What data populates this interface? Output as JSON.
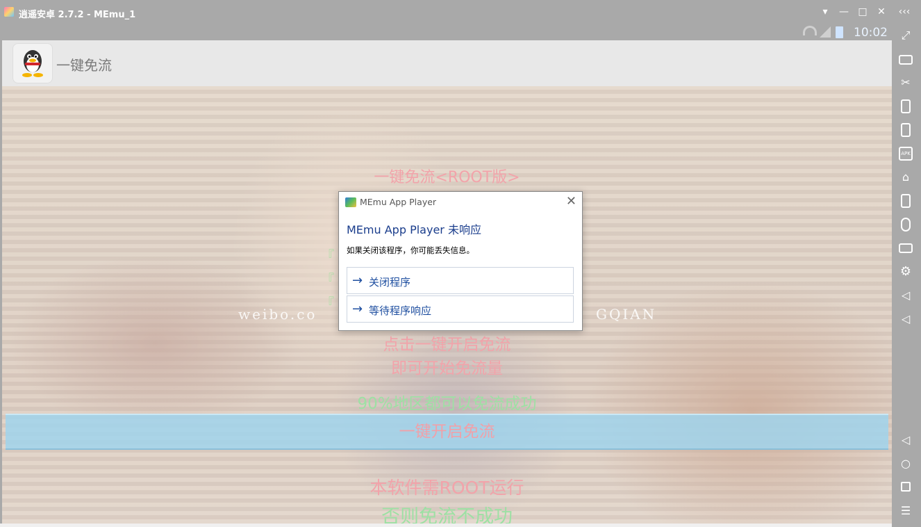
{
  "window": {
    "title": "逍遥安卓 2.7.2 - MEmu_1",
    "controls": [
      "menu-icon",
      "minimize-icon",
      "maximize-icon",
      "close-icon",
      "collapse-icon"
    ]
  },
  "statusbar": {
    "time": "10:02",
    "icons": [
      "wifi-icon",
      "signal-icon",
      "battery-icon"
    ]
  },
  "appbar": {
    "app_name": "一键免流",
    "logo": "penguin-icon"
  },
  "content": {
    "headline": "一键免流<ROOT版>",
    "watermark_left": "weibo.co",
    "watermark_right": "GQIAN",
    "side_lines": [
      "『",
      "『",
      "『"
    ],
    "instruction_1": "点击一键开启免流",
    "instruction_2": "即可开始免流量",
    "success_note": "90%地区都可以免流成功",
    "start_button_label": "一键开启免流",
    "root_note_1": "本软件需ROOT运行",
    "root_note_2": "否则免流不成功",
    "colors": {
      "pink": "#f2a3aa",
      "green": "#9ee0a4",
      "button_bg": "#a0d4ec"
    }
  },
  "dialog": {
    "caption": "MEmu App Player",
    "heading": "MEmu App Player 未响应",
    "message": "如果关闭该程序，你可能丢失信息。",
    "options": [
      {
        "label": "关闭程序"
      },
      {
        "label": "等待程序响应"
      }
    ]
  },
  "sidebar": {
    "tools": [
      "fullscreen-icon",
      "keyboard-icon",
      "screenshot-icon",
      "shake-icon",
      "rotate-icon",
      "apk-install-icon",
      "shared-folder-icon",
      "operation-record-icon",
      "mouse-icon",
      "camera-icon",
      "settings-icon",
      "volume-up-icon",
      "volume-down-icon"
    ],
    "nav": [
      "back-icon",
      "home-icon",
      "recent-apps-icon",
      "menu-list-icon"
    ]
  }
}
